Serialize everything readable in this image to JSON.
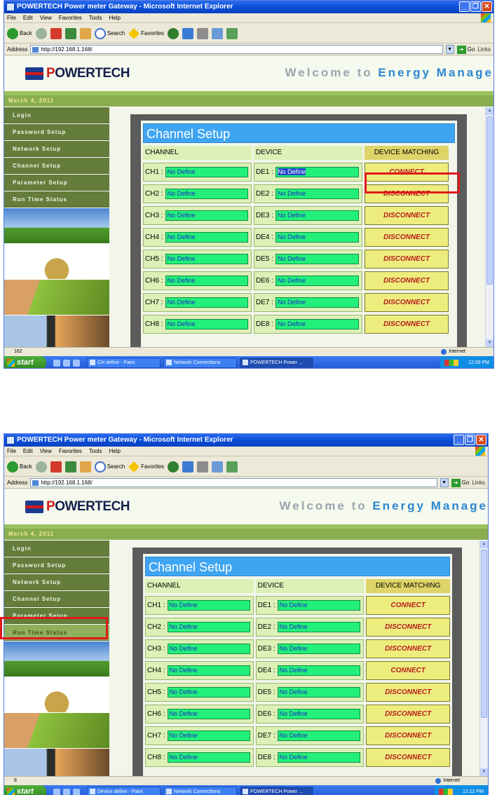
{
  "window": {
    "title": "POWERTECH Power meter Gateway - Microsoft Internet Explorer"
  },
  "menu": [
    "File",
    "Edit",
    "View",
    "Favorites",
    "Tools",
    "Help"
  ],
  "toolbar": {
    "back": "Back",
    "search": "Search",
    "favorites": "Favorites"
  },
  "address": {
    "label": "Address",
    "url": "http://192.168.1.168/",
    "go": "Go",
    "links": "Links"
  },
  "site": {
    "brand_o": "P",
    "brand_rest": "OWERTECH",
    "welcome_prefix": "Welcome to ",
    "welcome_highlight": "Energy Manage",
    "date": "March 4, 2011"
  },
  "nav": [
    "Login",
    "Password Setup",
    "Network Setup",
    "Channel Setup",
    "Parameter Setup",
    "Run Time Status"
  ],
  "panel": {
    "title": "Channel Setup",
    "col_channel": "CHANNEL",
    "col_device": "DEVICE",
    "col_matching": "DEVICE MATCHING"
  },
  "rows": [
    {
      "ch": "CH1 :",
      "ch_val": "No Define",
      "de": "DE1 :",
      "de_val": "No Define",
      "s1_btn": "CONNECT",
      "s2_btn": "CONNECT"
    },
    {
      "ch": "CH2 :",
      "ch_val": "No Define",
      "de": "DE2 :",
      "de_val": "No Define",
      "s1_btn": "DISCONNECT",
      "s2_btn": "DISCONNECT"
    },
    {
      "ch": "CH3 :",
      "ch_val": "No Define",
      "de": "DE3 :",
      "de_val": "No Define",
      "s1_btn": "DISCONNECT",
      "s2_btn": "DISCONNECT"
    },
    {
      "ch": "CH4 :",
      "ch_val": "No Define",
      "de": "DE4 :",
      "de_val": "No Define",
      "s1_btn": "DISCONNECT",
      "s2_btn": "CONNECT"
    },
    {
      "ch": "CH5 :",
      "ch_val": "No Define",
      "de": "DE5 :",
      "de_val": "No Define",
      "s1_btn": "DISCONNECT",
      "s2_btn": "DISCONNECT"
    },
    {
      "ch": "CH6 :",
      "ch_val": "No Define",
      "de": "DE6 :",
      "de_val": "No Define",
      "s1_btn": "DISCONNECT",
      "s2_btn": "DISCONNECT"
    },
    {
      "ch": "CH7 :",
      "ch_val": "No Define",
      "de": "DE7 :",
      "de_val": "No Define",
      "s1_btn": "DISCONNECT",
      "s2_btn": "DISCONNECT"
    },
    {
      "ch": "CH8 :",
      "ch_val": "No Define",
      "de": "DE8 :",
      "de_val": "No Define",
      "s1_btn": "DISCONNECT",
      "s2_btn": "DISCONNECT"
    }
  ],
  "shot1": {
    "status": "162",
    "zone": "Internet",
    "tasks": [
      "CH define - Paint",
      "Network Connections",
      "POWERTECH Power ..."
    ],
    "clock": "12:09 PM"
  },
  "shot2": {
    "status": "8",
    "zone": "Internet",
    "tasks": [
      "Device define - Paint",
      "Network Connections",
      "POWERTECH Power ..."
    ],
    "clock": "12:12 PM"
  },
  "taskbar": {
    "start": "start"
  },
  "colors": {
    "highlight": "#e0191a",
    "nav_bg": "#647d3a",
    "field_green": "#22f07a",
    "title_blue": "#3fa5f2"
  }
}
